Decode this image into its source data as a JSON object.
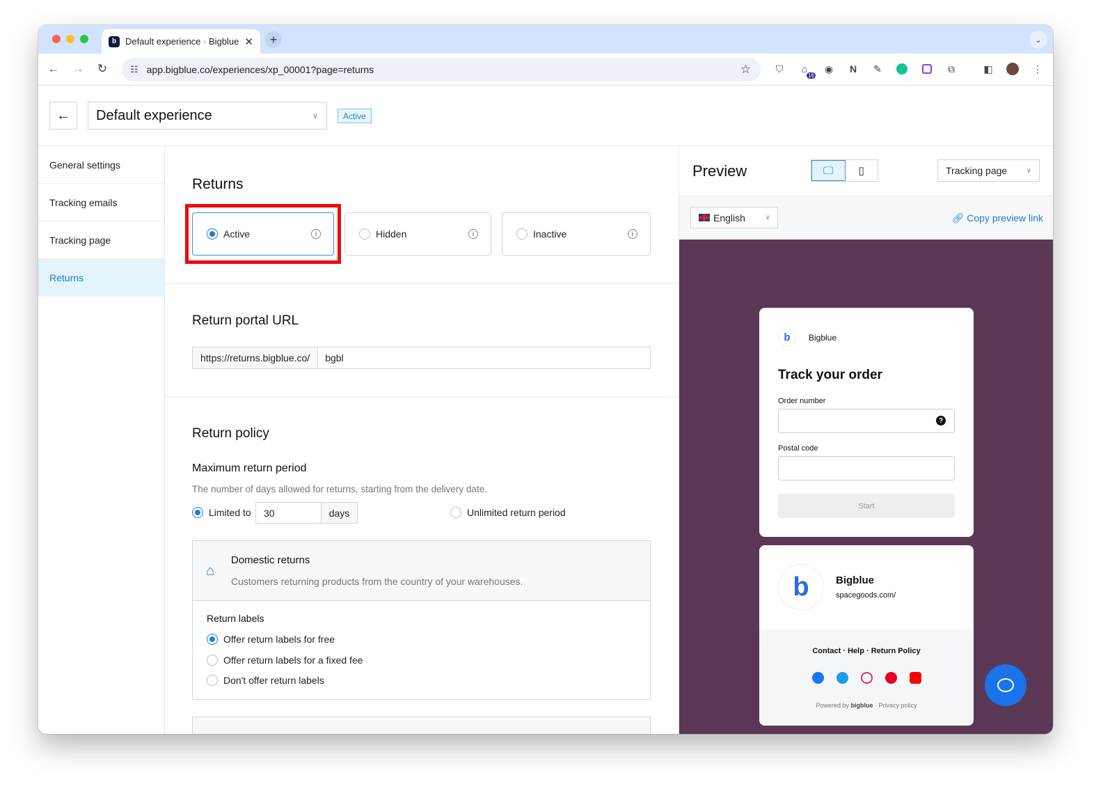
{
  "browser": {
    "tab_title": "Default experience · Bigblue",
    "tab_favicon": "b",
    "url": "app.bigblue.co/experiences/xp_00001?page=returns",
    "extension_badge": "16"
  },
  "header": {
    "experience_name": "Default experience",
    "status_badge": "Active"
  },
  "sidebar": {
    "items": [
      {
        "label": "General settings"
      },
      {
        "label": "Tracking emails"
      },
      {
        "label": "Tracking page"
      },
      {
        "label": "Returns"
      }
    ]
  },
  "returns": {
    "title": "Returns",
    "status_options": [
      {
        "label": "Active",
        "selected": true
      },
      {
        "label": "Hidden",
        "selected": false
      },
      {
        "label": "Inactive",
        "selected": false
      }
    ]
  },
  "portal_url": {
    "title": "Return portal URL",
    "prefix": "https://returns.bigblue.co/",
    "value": "bgbl"
  },
  "policy": {
    "title": "Return policy",
    "period_label": "Maximum return period",
    "period_desc": "The number of days allowed for returns, starting from the delivery date.",
    "limited_label": "Limited to",
    "days_value": "30",
    "days_unit": "days",
    "unlimited_label": "Unlimited return period",
    "domestic": {
      "title": "Domestic returns",
      "desc": "Customers returning products from the country of your warehouses.",
      "labels_title": "Return labels",
      "options": [
        {
          "label": "Offer return labels for free",
          "selected": true
        },
        {
          "label": "Offer return labels for a fixed fee",
          "selected": false
        },
        {
          "label": "Don't offer return labels",
          "selected": false
        }
      ]
    }
  },
  "preview": {
    "title": "Preview",
    "page_select": "Tracking page",
    "language": "English",
    "copy_link": "Copy preview link",
    "brand": "Bigblue",
    "track_title": "Track your order",
    "order_number_label": "Order number",
    "postal_code_label": "Postal code",
    "start_button": "Start",
    "footer_brand": "Bigblue",
    "footer_url": "spacegoods.com/",
    "footer_links": [
      "Contact",
      "Help",
      "Return Policy"
    ],
    "powered_by": "Powered by",
    "powered_brand": "bigblue",
    "privacy": "· Privacy policy",
    "colors": {
      "canvas": "#5b3756",
      "accent": "#1f7ae0"
    }
  }
}
